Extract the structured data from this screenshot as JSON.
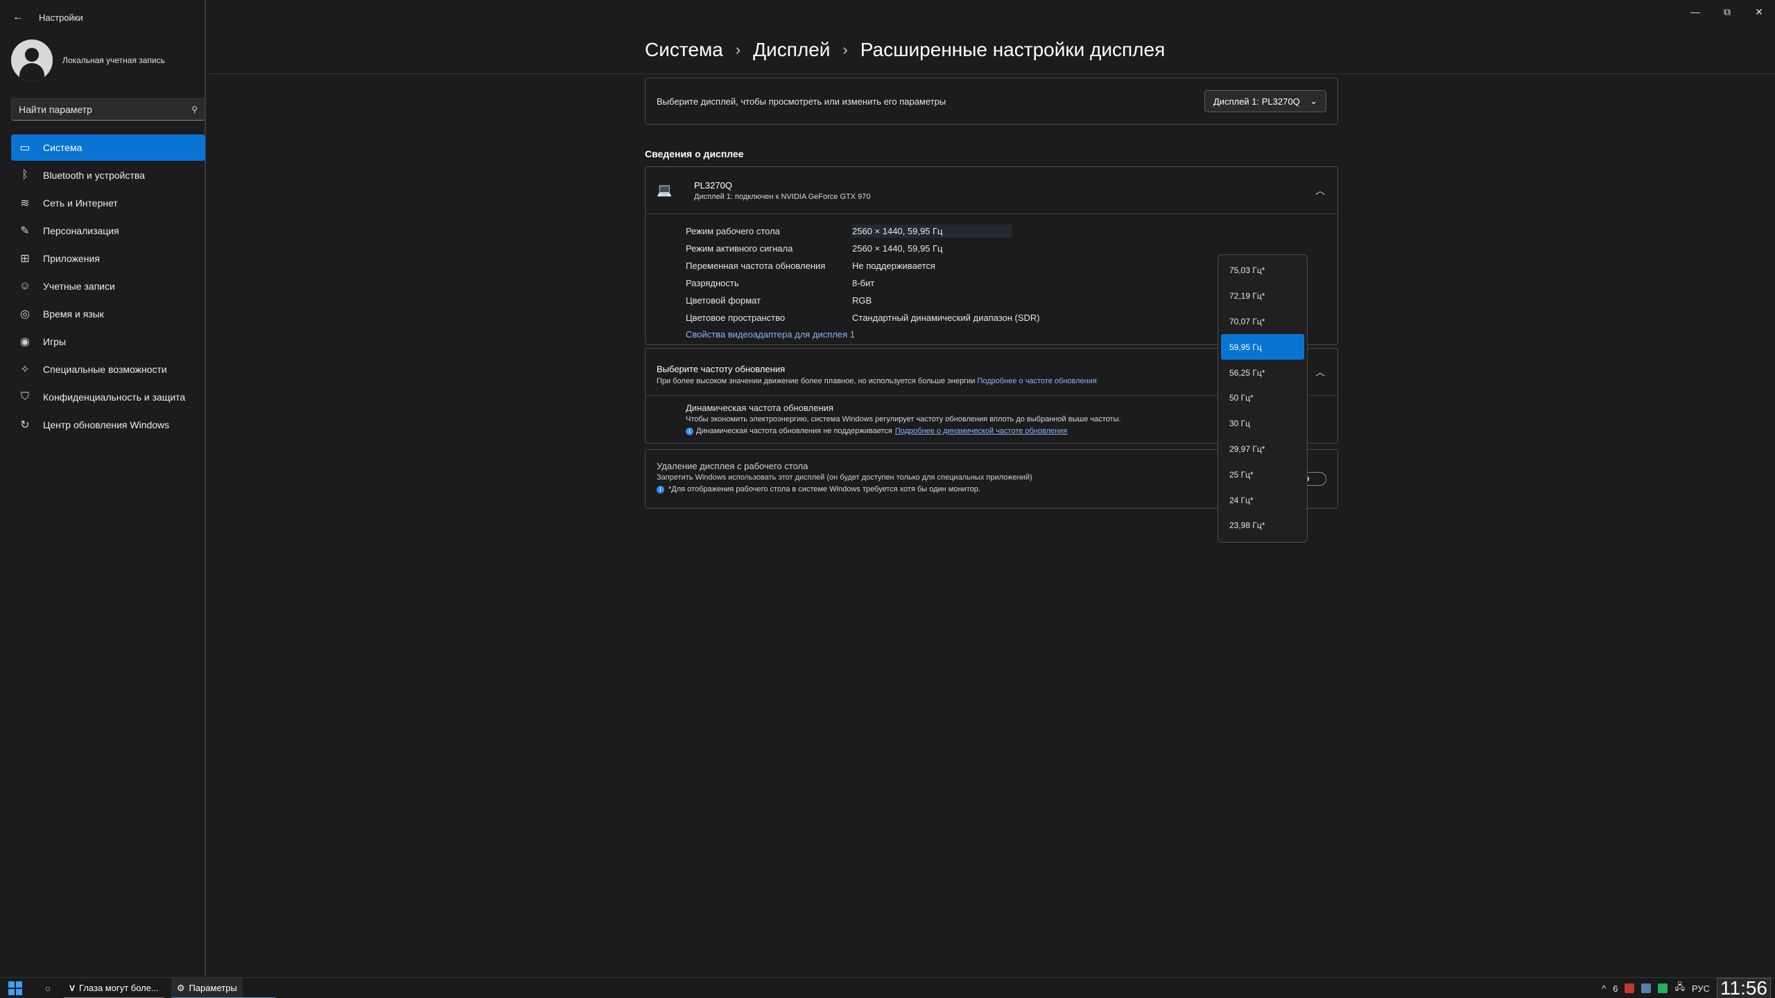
{
  "window": {
    "back_label": "Настройки",
    "controls": [
      "—",
      "⧉",
      "✕"
    ]
  },
  "account": {
    "name": "Локальная учетная запись"
  },
  "search": {
    "placeholder": "Найти параметр"
  },
  "sidebar": {
    "items": [
      {
        "label": "Система",
        "icon": "monitor-icon",
        "active": true
      },
      {
        "label": "Bluetooth и устройства",
        "icon": "bluetooth-icon"
      },
      {
        "label": "Сеть и Интернет",
        "icon": "wifi-icon"
      },
      {
        "label": "Персонализация",
        "icon": "brush-icon"
      },
      {
        "label": "Приложения",
        "icon": "apps-icon"
      },
      {
        "label": "Учетные записи",
        "icon": "person-icon"
      },
      {
        "label": "Время и язык",
        "icon": "globe-icon"
      },
      {
        "label": "Игры",
        "icon": "gamepad-icon"
      },
      {
        "label": "Специальные возможности",
        "icon": "accessibility-icon"
      },
      {
        "label": "Конфиденциальность и защита",
        "icon": "shield-icon"
      },
      {
        "label": "Центр обновления Windows",
        "icon": "update-icon"
      }
    ]
  },
  "breadcrumb": {
    "part1": "Система",
    "part2": "Дисплей",
    "part3": "Расширенные настройки дисплея"
  },
  "select_display": {
    "text": "Выберите дисплей, чтобы просмотреть или изменить его параметры",
    "dropdown_value": "Дисплей 1: PL3270Q"
  },
  "display_info": {
    "section_label": "Сведения о дисплее",
    "name": "PL3270Q",
    "subtitle": "Дисплей 1: подключен к NVIDIA GeForce GTX 970",
    "rows": [
      {
        "key": "Режим рабочего стола",
        "value": "2560 × 1440, 59,95 Гц"
      },
      {
        "key": "Режим активного сигнала",
        "value": "2560 × 1440, 59,95 Гц"
      },
      {
        "key": "Переменная частота обновления",
        "value": "Не поддерживается"
      },
      {
        "key": "Разрядность",
        "value": "8-бит"
      },
      {
        "key": "Цветовой формат",
        "value": "RGB"
      },
      {
        "key": "Цветовое пространство",
        "value": "Стандартный динамический диапазон (SDR)"
      }
    ],
    "adapter_link": "Свойства видеоадаптера для дисплея 1"
  },
  "refresh": {
    "title": "Выберите частоту обновления",
    "subtitle": "При более высоком значении движение более плавное, но используется больше энергии",
    "link": "Подробнее о частоте обновления",
    "dynamic_title": "Динамическая частота обновления",
    "dynamic_subtitle": "Чтобы экономить электроэнергию, система Windows регулирует частоту обновления вплоть до выбранной выше частоты.",
    "dynamic_note": "Динамическая частота обновления не поддерживается",
    "dynamic_link": "Подробнее о динамической частоте обновления",
    "options": [
      "75,03 Гц*",
      "72,19 Гц*",
      "70,07 Гц*",
      "59,95 Гц",
      "56,25 Гц*",
      "50 Гц*",
      "30 Гц",
      "29,97 Гц*",
      "25 Гц*",
      "24 Гц*",
      "23,98 Гц*"
    ],
    "selected_index": 3
  },
  "remove_display": {
    "title": "Удаление дисплея с рабочего стола",
    "subtitle": "Запретить Windows использовать этот дисплей (он будет доступен только для специальных приложений)",
    "note": "*Для отображения рабочего стола в системе Windows требуется хотя бы один монитор."
  },
  "taskbar": {
    "app1": "Глаза могут боле...",
    "app1_glyph": "V",
    "app2": "Параметры",
    "tray_up": "^",
    "tray_badge": "6",
    "lang": "РУС",
    "clock": "11:56"
  },
  "colors": {
    "accent": "#0a74d4",
    "link": "#8ab4ff"
  }
}
